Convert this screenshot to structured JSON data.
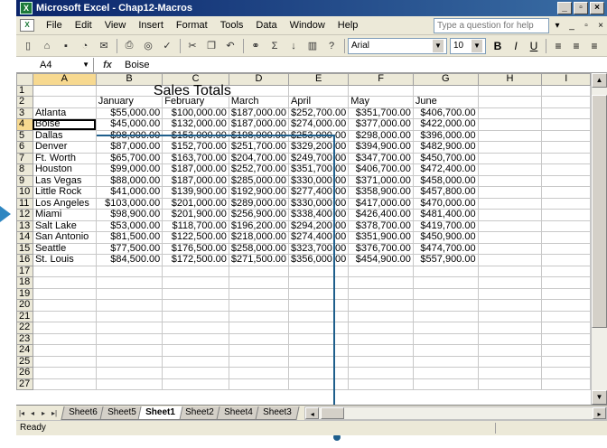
{
  "window": {
    "app_icon": "excel-icon",
    "title": "Microsoft Excel - Chap12-Macros",
    "controls": [
      "_",
      "▫",
      "×"
    ]
  },
  "menu": {
    "items": [
      "File",
      "Edit",
      "View",
      "Insert",
      "Format",
      "Tools",
      "Data",
      "Window",
      "Help"
    ],
    "ask_placeholder": "Type a question for help",
    "controls": [
      "▾",
      "_",
      "▫",
      "×"
    ]
  },
  "toolbar": {
    "icons": [
      "new-icon",
      "open-icon",
      "save-icon",
      "permission-icon",
      "email-icon",
      "print-icon",
      "print-preview-icon",
      "spelling-icon",
      "cut-icon",
      "copy-icon",
      "undo-icon",
      "hyperlink-icon",
      "autosum-icon",
      "sort-ascending-icon",
      "chart-wizard-icon",
      "help-icon"
    ],
    "font": "Arial",
    "font_size": "10",
    "bold": "B",
    "italic": "I",
    "underline": "U"
  },
  "formula_bar": {
    "name_box": "A4",
    "fx": "fx",
    "value": "Boise"
  },
  "columns": [
    "A",
    "B",
    "C",
    "D",
    "E",
    "F",
    "G",
    "H",
    "I"
  ],
  "sheet": {
    "title": "Sales Totals",
    "months": [
      "January",
      "February",
      "March",
      "April",
      "May",
      "June"
    ],
    "rows": [
      {
        "city": "Atlanta",
        "values": [
          "$55,000.00",
          "$100,000.00",
          "$187,000.00",
          "$252,700.00",
          "$351,700.00",
          "$406,700.00"
        ]
      },
      {
        "city": "Boise",
        "values": [
          "$45,000.00",
          "$132,000.00",
          "$187,000.00",
          "$274,000.00",
          "$377,000.00",
          "$422,000.00"
        ]
      },
      {
        "city": "Dallas",
        "values": [
          "$98,000.00",
          "$153,000.00",
          "$198,000.00",
          "$253,000.00",
          "$298,000.00",
          "$396,000.00"
        ]
      },
      {
        "city": "Denver",
        "values": [
          "$87,000.00",
          "$152,700.00",
          "$251,700.00",
          "$329,200.00",
          "$394,900.00",
          "$482,900.00"
        ]
      },
      {
        "city": "Ft. Worth",
        "values": [
          "$65,700.00",
          "$163,700.00",
          "$204,700.00",
          "$249,700.00",
          "$347,700.00",
          "$450,700.00"
        ]
      },
      {
        "city": "Houston",
        "values": [
          "$99,000.00",
          "$187,000.00",
          "$252,700.00",
          "$351,700.00",
          "$406,700.00",
          "$472,400.00"
        ]
      },
      {
        "city": "Las Vegas",
        "values": [
          "$88,000.00",
          "$187,000.00",
          "$285,000.00",
          "$330,000.00",
          "$371,000.00",
          "$458,000.00"
        ]
      },
      {
        "city": "Little Rock",
        "values": [
          "$41,000.00",
          "$139,900.00",
          "$192,900.00",
          "$277,400.00",
          "$358,900.00",
          "$457,800.00"
        ]
      },
      {
        "city": "Los Angeles",
        "values": [
          "$103,000.00",
          "$201,000.00",
          "$289,000.00",
          "$330,000.00",
          "$417,000.00",
          "$470,000.00"
        ]
      },
      {
        "city": "Miami",
        "values": [
          "$98,900.00",
          "$201,900.00",
          "$256,900.00",
          "$338,400.00",
          "$426,400.00",
          "$481,400.00"
        ]
      },
      {
        "city": "Salt Lake",
        "values": [
          "$53,000.00",
          "$118,700.00",
          "$196,200.00",
          "$294,200.00",
          "$378,700.00",
          "$419,700.00"
        ]
      },
      {
        "city": "San Antonio",
        "values": [
          "$81,500.00",
          "$122,500.00",
          "$218,000.00",
          "$274,400.00",
          "$351,900.00",
          "$450,900.00"
        ]
      },
      {
        "city": "Seattle",
        "values": [
          "$77,500.00",
          "$176,500.00",
          "$258,000.00",
          "$323,700.00",
          "$376,700.00",
          "$474,700.00"
        ]
      },
      {
        "city": "St. Louis",
        "values": [
          "$84,500.00",
          "$172,500.00",
          "$271,500.00",
          "$356,000.00",
          "$454,900.00",
          "$557,900.00"
        ]
      }
    ],
    "total_rows": 27
  },
  "tabs": {
    "items": [
      "Sheet6",
      "Sheet5",
      "Sheet1",
      "Sheet2",
      "Sheet4",
      "Sheet3"
    ],
    "active": "Sheet1",
    "nav": [
      "|◂",
      "◂",
      "▸",
      "▸|"
    ]
  },
  "status": {
    "text": "Ready"
  },
  "colors": {
    "title_bar": "#0a246a",
    "chrome": "#ece9d8",
    "callout": "#1f5f8c",
    "pointer": "#2e86c1"
  }
}
